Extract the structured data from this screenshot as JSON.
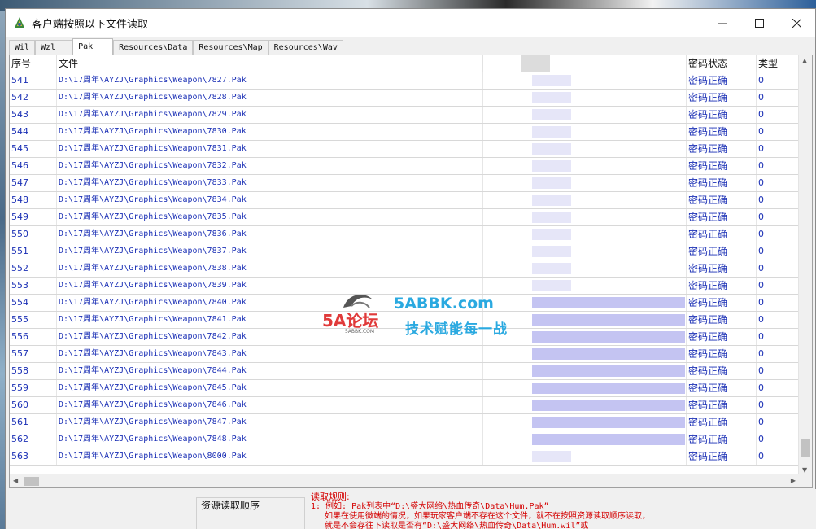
{
  "window": {
    "title": "客户端按照以下文件读取"
  },
  "tabs": [
    {
      "label": "Wil",
      "active": false
    },
    {
      "label": "Wzl",
      "active": false
    },
    {
      "label": "Pak",
      "active": true
    },
    {
      "label": "Resources\\Data",
      "active": false
    },
    {
      "label": "Resources\\Map",
      "active": false
    },
    {
      "label": "Resources\\Wav",
      "active": false
    }
  ],
  "table": {
    "headers": {
      "no": "序号",
      "file": "文件",
      "status": "密码状态",
      "type": "类型"
    },
    "rows": [
      {
        "no": "541",
        "file": "D:\\17周年\\AYZJ\\Graphics\\Weapon\\7827.Pak",
        "status": "密码正确",
        "type": "0"
      },
      {
        "no": "542",
        "file": "D:\\17周年\\AYZJ\\Graphics\\Weapon\\7828.Pak",
        "status": "密码正确",
        "type": "0"
      },
      {
        "no": "543",
        "file": "D:\\17周年\\AYZJ\\Graphics\\Weapon\\7829.Pak",
        "status": "密码正确",
        "type": "0"
      },
      {
        "no": "544",
        "file": "D:\\17周年\\AYZJ\\Graphics\\Weapon\\7830.Pak",
        "status": "密码正确",
        "type": "0"
      },
      {
        "no": "545",
        "file": "D:\\17周年\\AYZJ\\Graphics\\Weapon\\7831.Pak",
        "status": "密码正确",
        "type": "0"
      },
      {
        "no": "546",
        "file": "D:\\17周年\\AYZJ\\Graphics\\Weapon\\7832.Pak",
        "status": "密码正确",
        "type": "0"
      },
      {
        "no": "547",
        "file": "D:\\17周年\\AYZJ\\Graphics\\Weapon\\7833.Pak",
        "status": "密码正确",
        "type": "0"
      },
      {
        "no": "548",
        "file": "D:\\17周年\\AYZJ\\Graphics\\Weapon\\7834.Pak",
        "status": "密码正确",
        "type": "0"
      },
      {
        "no": "549",
        "file": "D:\\17周年\\AYZJ\\Graphics\\Weapon\\7835.Pak",
        "status": "密码正确",
        "type": "0"
      },
      {
        "no": "550",
        "file": "D:\\17周年\\AYZJ\\Graphics\\Weapon\\7836.Pak",
        "status": "密码正确",
        "type": "0"
      },
      {
        "no": "551",
        "file": "D:\\17周年\\AYZJ\\Graphics\\Weapon\\7837.Pak",
        "status": "密码正确",
        "type": "0"
      },
      {
        "no": "552",
        "file": "D:\\17周年\\AYZJ\\Graphics\\Weapon\\7838.Pak",
        "status": "密码正确",
        "type": "0"
      },
      {
        "no": "553",
        "file": "D:\\17周年\\AYZJ\\Graphics\\Weapon\\7839.Pak",
        "status": "密码正确",
        "type": "0"
      },
      {
        "no": "554",
        "file": "D:\\17周年\\AYZJ\\Graphics\\Weapon\\7840.Pak",
        "status": "密码正确",
        "type": "0"
      },
      {
        "no": "555",
        "file": "D:\\17周年\\AYZJ\\Graphics\\Weapon\\7841.Pak",
        "status": "密码正确",
        "type": "0"
      },
      {
        "no": "556",
        "file": "D:\\17周年\\AYZJ\\Graphics\\Weapon\\7842.Pak",
        "status": "密码正确",
        "type": "0"
      },
      {
        "no": "557",
        "file": "D:\\17周年\\AYZJ\\Graphics\\Weapon\\7843.Pak",
        "status": "密码正确",
        "type": "0"
      },
      {
        "no": "558",
        "file": "D:\\17周年\\AYZJ\\Graphics\\Weapon\\7844.Pak",
        "status": "密码正确",
        "type": "0"
      },
      {
        "no": "559",
        "file": "D:\\17周年\\AYZJ\\Graphics\\Weapon\\7845.Pak",
        "status": "密码正确",
        "type": "0"
      },
      {
        "no": "560",
        "file": "D:\\17周年\\AYZJ\\Graphics\\Weapon\\7846.Pak",
        "status": "密码正确",
        "type": "0"
      },
      {
        "no": "561",
        "file": "D:\\17周年\\AYZJ\\Graphics\\Weapon\\7847.Pak",
        "status": "密码正确",
        "type": "0"
      },
      {
        "no": "562",
        "file": "D:\\17周年\\AYZJ\\Graphics\\Weapon\\7848.Pak",
        "status": "密码正确",
        "type": "0"
      },
      {
        "no": "563",
        "file": "D:\\17周年\\AYZJ\\Graphics\\Weapon\\8000.Pak",
        "status": "密码正确",
        "type": "0"
      }
    ]
  },
  "watermark": {
    "domain": "5ABBK.com",
    "slogan": "技术赋能每一战",
    "brand": "5A论坛",
    "brand_sub": "5ABBK.COM"
  },
  "bottom": {
    "group_title": "资源读取顺序",
    "rules_title": "读取规则:",
    "rules": [
      "1: 例如: Pak列表中“D:\\盛大网络\\热血传奇\\Data\\Hum.Pak”",
      "如果在使用微端的情况，如果玩家客户端不存在这个文件，就不在按照资源读取顺序读取，",
      "就是不会存往下读取是否有“D:\\盛大网络\\热血传奇\\Data\\Hum.wil”或"
    ]
  },
  "colors": {
    "link_blue": "#1a2fb5",
    "rule_red": "#d40000",
    "watermark_blue": "#2aa9e0",
    "watermark_red": "#e03a3a"
  }
}
